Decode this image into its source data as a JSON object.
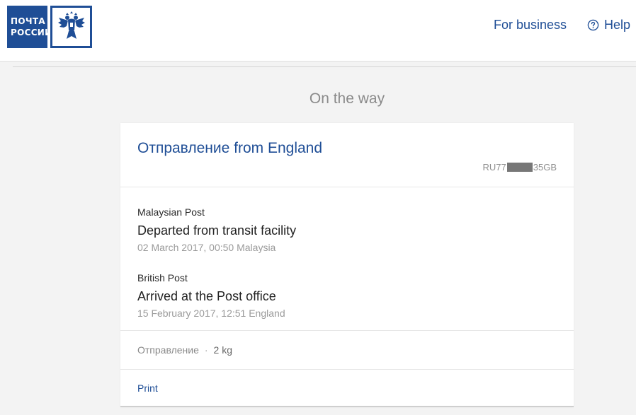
{
  "header": {
    "logo_line1": "ПОЧТА",
    "logo_line2": "РОССИИ",
    "nav_business": "For business",
    "nav_help": "Help"
  },
  "status": {
    "title": "On the way"
  },
  "card": {
    "title": "Отправление from England",
    "tracking_prefix": "RU77",
    "tracking_suffix": "35GB"
  },
  "events": [
    {
      "operator": "Malaysian Post",
      "title": "Departed from transit facility",
      "date": "02 March 2017, 00:50 Malaysia"
    },
    {
      "operator": "British Post",
      "title": "Arrived at the Post office",
      "date": "15 February 2017, 12:51 England"
    }
  ],
  "meta": {
    "type": "Отправление",
    "separator": "·",
    "weight": "2 kg"
  },
  "actions": {
    "print": "Print"
  },
  "colors": {
    "brand_blue": "#1f4e96",
    "background": "#f3f3f3"
  },
  "icons": {
    "emblem": "double-headed-eagle-emblem",
    "help": "question-circle-icon"
  }
}
